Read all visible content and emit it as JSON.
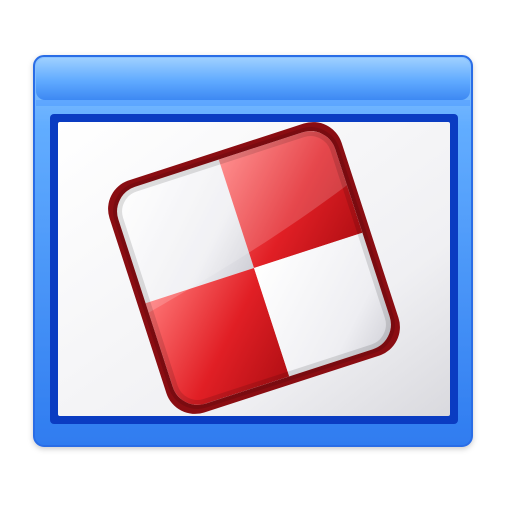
{
  "icon": {
    "name": "window-with-checkered-tile",
    "window_frame": {
      "color_light": "#8cc4ff",
      "color_mid": "#4b9dff",
      "color_dark": "#0d4fd8",
      "border": "#2a6de6",
      "content_border": "#0a3cc2"
    },
    "content": {
      "bg_top": "#ffffff",
      "bg_bottom": "#d8d8dc"
    },
    "tile": {
      "outline": "#8a0d12",
      "red_light": "#ff6b6b",
      "red_mid": "#e11f25",
      "red_dark": "#b20f14",
      "white": "#f2f2f4",
      "white_shadow": "#cfcfd6"
    }
  }
}
